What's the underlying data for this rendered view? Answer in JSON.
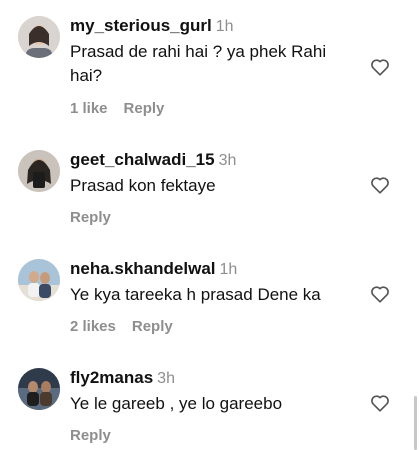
{
  "comments": [
    {
      "username": "my_sterious_gurl",
      "time": "1h",
      "text": "Prasad de rahi hai ? ya phek Rahi hai?",
      "likes": "1 like",
      "reply": "Reply"
    },
    {
      "username": "geet_chalwadi_15",
      "time": "3h",
      "text": "Prasad kon fektaye",
      "likes": "",
      "reply": "Reply"
    },
    {
      "username": "neha.skhandelwal",
      "time": "1h",
      "text": "Ye kya tareeka h prasad Dene ka",
      "likes": "2 likes",
      "reply": "Reply"
    },
    {
      "username": "fly2manas",
      "time": "3h",
      "text": "Ye le gareeb , ye lo gareebo",
      "likes": "",
      "reply": "Reply"
    }
  ],
  "icons": {
    "like": "heart-outline-icon"
  },
  "colors": {
    "muted": "#8e8e8e",
    "text": "#111111"
  }
}
